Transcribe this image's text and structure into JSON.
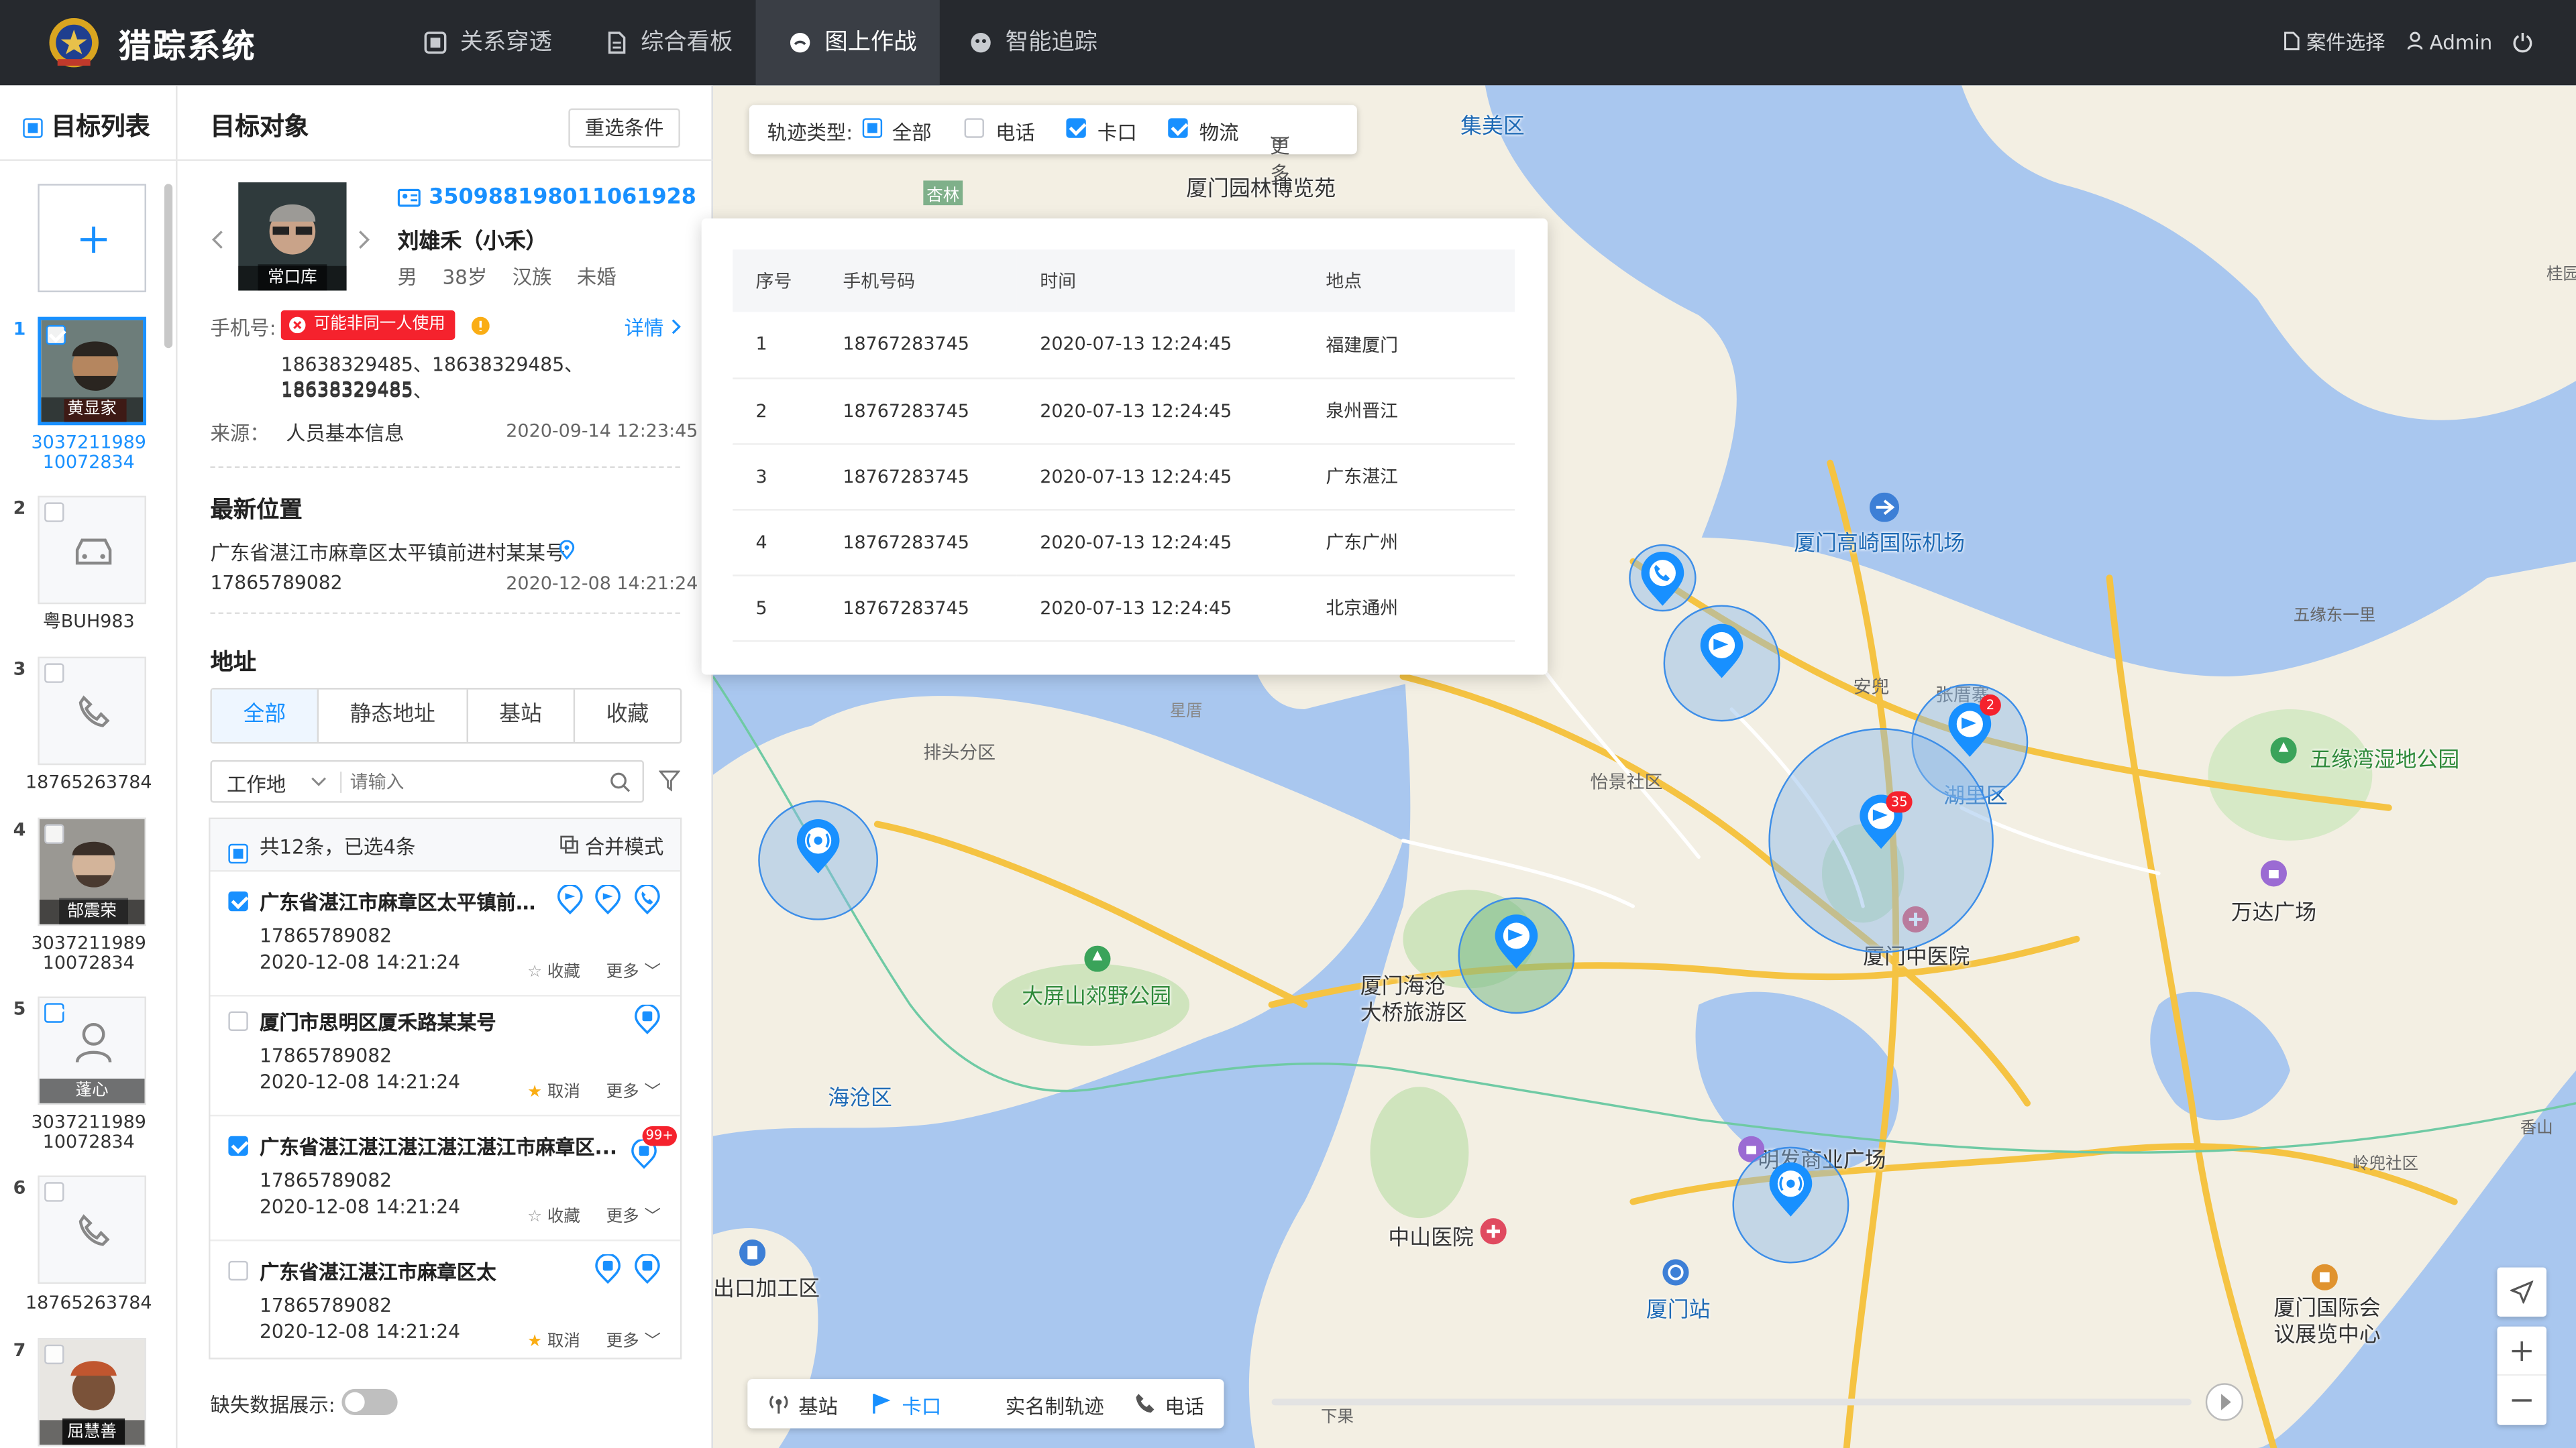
{
  "app": {
    "title": "猎踪系统"
  },
  "nav": [
    {
      "label": "关系穿透",
      "icon": "relation-icon",
      "active": false
    },
    {
      "label": "综合看板",
      "icon": "dashboard-icon",
      "active": false
    },
    {
      "label": "图上作战",
      "icon": "map-battle-icon",
      "active": true
    },
    {
      "label": "智能追踪",
      "icon": "tracking-icon",
      "active": false
    }
  ],
  "header_right": {
    "case_select": "案件选择",
    "user": "Admin"
  },
  "target_list": {
    "title": "目标列表",
    "items": [
      {
        "num": "1",
        "type": "photo",
        "caption": "黄显家",
        "label": "3037211989\n10072834",
        "checked": true
      },
      {
        "num": "2",
        "type": "car",
        "caption": "",
        "label": "粤BUH983",
        "checked": false
      },
      {
        "num": "3",
        "type": "phone",
        "caption": "",
        "label": "18765263784",
        "checked": false
      },
      {
        "num": "4",
        "type": "photo",
        "caption": "郜震荣",
        "label": "3037211989\n10072834",
        "checked": false
      },
      {
        "num": "5",
        "type": "person",
        "caption": "蓬心",
        "label": "3037211989\n10072834",
        "checked": true
      },
      {
        "num": "6",
        "type": "phone",
        "caption": "",
        "label": "18765263784",
        "checked": false
      },
      {
        "num": "7",
        "type": "photo",
        "caption": "屈慧善",
        "label": "",
        "checked": false
      }
    ]
  },
  "detail": {
    "title": "目标对象",
    "reset_button": "重选条件",
    "photo_caption": "常口库",
    "id_number": "350988198011061928",
    "name": "刘雄禾（小禾）",
    "gender": "男",
    "age": "38岁",
    "ethnicity": "汉族",
    "marital": "未婚",
    "phone_label": "手机号:",
    "phone_warning": "可能非同一人使用",
    "detail_link": "详情",
    "phones_line1": "18638329485、18638329485、18638329485、",
    "phones_line2": "18638329485",
    "source_label": "来源：",
    "source_value": "人员基本信息",
    "source_time": "2020-09-14  12:23:45",
    "latest_title": "最新位置",
    "latest_address": "广东省湛江市麻章区太平镇前进村某某号",
    "latest_phone": "17865789082",
    "latest_time": "2020-12-08  14:21:24",
    "address_title": "地址",
    "tabs": [
      "全部",
      "静态地址",
      "基站",
      "收藏"
    ],
    "filter_select": "工作地",
    "search_placeholder": "请输入",
    "summary": "共12条，已选4条",
    "merge_mode": "合并模式",
    "addresses": [
      {
        "title": "广东省湛江市麻章区太平镇前进...",
        "phone": "17865789082",
        "time": "2020-12-08  14:21:24",
        "fav": "收藏",
        "more": "更多",
        "checked": true,
        "starred": false
      },
      {
        "title": "厦门市思明区厦禾路某某号",
        "phone": "17865789082",
        "time": "2020-12-08  14:21:24",
        "fav": "取消",
        "more": "更多",
        "checked": false,
        "starred": true
      },
      {
        "title": "广东省湛江湛江湛江湛江湛江市麻章区...",
        "phone": "17865789082",
        "time": "2020-12-08  14:21:24",
        "fav": "收藏",
        "more": "更多",
        "checked": true,
        "starred": false,
        "badge": "99+"
      },
      {
        "title": "广东省湛江湛江市麻章区太",
        "phone": "17865789082",
        "time": "2020-12-08  14:21:24",
        "fav": "取消",
        "more": "更多",
        "checked": false,
        "starred": true
      }
    ],
    "missing_data_label": "缺失数据展示:"
  },
  "map": {
    "filter": {
      "label": "轨迹类型:",
      "options": [
        "全部",
        "电话",
        "卡口",
        "物流"
      ],
      "more": "更多"
    },
    "popup": {
      "headers": [
        "序号",
        "手机号码",
        "时间",
        "地点"
      ],
      "rows": [
        [
          "1",
          "18767283745",
          "2020-07-13  12:24:45",
          "福建厦门"
        ],
        [
          "2",
          "18767283745",
          "2020-07-13  12:24:45",
          "泉州晋江"
        ],
        [
          "3",
          "18767283745",
          "2020-07-13  12:24:45",
          "广东湛江"
        ],
        [
          "4",
          "18767283745",
          "2020-07-13  12:24:45",
          "广东广州"
        ],
        [
          "5",
          "18767283745",
          "2020-07-13  12:24:45",
          "北京通州"
        ]
      ]
    },
    "legend": [
      "基站",
      "卡口",
      "实名制轨迹",
      "电话"
    ],
    "labels": {
      "jimei": "集美区",
      "expo": "厦门园林博览苑",
      "xinglin": "杏林",
      "airport": "厦门高崎国际机场",
      "anbian": "安兜",
      "zhangcuo": "张厝寨",
      "huli": "湖里区",
      "wuyuan": "五缘湾湿地公园",
      "wanda": "万达广场",
      "paitou": "排头分区",
      "yijing": "怡景社区",
      "xingcuo": "星厝",
      "zhongyiyuan": "厦门中医院",
      "daping": "大屏山郊野公园",
      "haicang_bridge": "厦门海沧\n大桥旅游区",
      "haicang": "海沧区",
      "mingfa": "明发商业广场",
      "zhongshan": "中山医院",
      "xiamen_station": "厦门站",
      "export_zone": "出口加工区",
      "convention": "厦门国际会\n议展览中心",
      "wuyuandong": "五缘东一里",
      "lingguang": "岭兜社区",
      "xiangshan": "香山",
      "guize": "桂园",
      "xiabei": "下果"
    },
    "markers": {
      "badge1": "2",
      "badge2": "35"
    }
  }
}
